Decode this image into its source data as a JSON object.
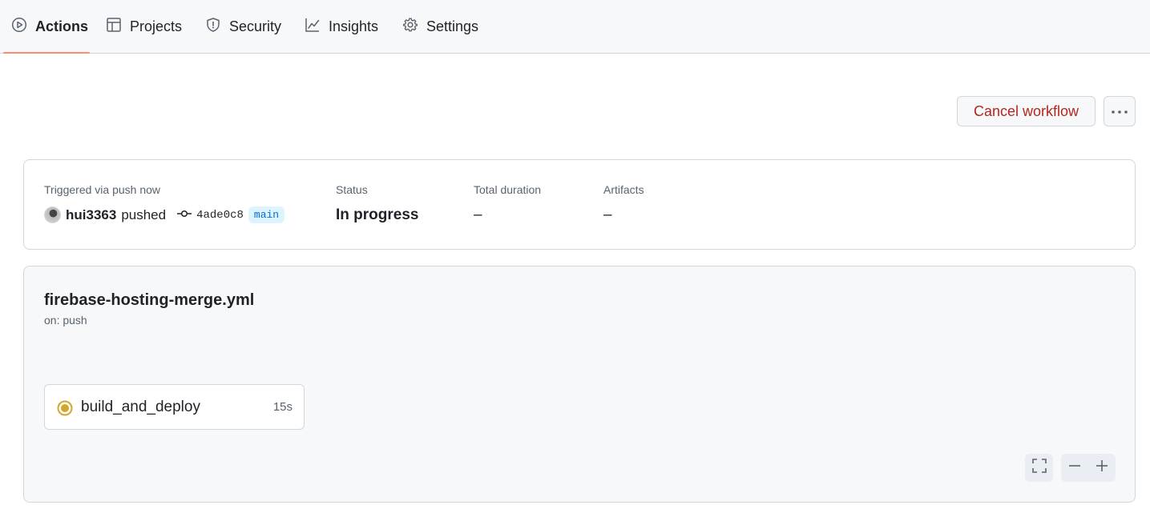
{
  "nav": {
    "tabs": [
      {
        "label": "Actions",
        "icon": "play-circle-icon",
        "active": true
      },
      {
        "label": "Projects",
        "icon": "table-icon",
        "active": false
      },
      {
        "label": "Security",
        "icon": "shield-icon",
        "active": false
      },
      {
        "label": "Insights",
        "icon": "graph-icon",
        "active": false
      },
      {
        "label": "Settings",
        "icon": "gear-icon",
        "active": false
      }
    ],
    "active_underline_color": "#fd8c73"
  },
  "header": {
    "cancel_label": "Cancel workflow",
    "more_icon": "kebab-horizontal-icon"
  },
  "summary": {
    "triggered_label": "Triggered via push now",
    "user": "hui3363",
    "action": "pushed",
    "commit": "4ade0c8",
    "branch": "main",
    "status_label": "Status",
    "status_value": "In progress",
    "duration_label": "Total duration",
    "duration_value": "–",
    "artifacts_label": "Artifacts",
    "artifacts_value": "–"
  },
  "graph": {
    "workflow_file": "firebase-hosting-merge.yml",
    "trigger": "on: push",
    "jobs": [
      {
        "name": "build_and_deploy",
        "duration": "15s",
        "status": "in_progress",
        "status_color": "#d4a72c"
      }
    ],
    "controls": [
      "fullscreen-icon",
      "zoom-out-icon",
      "zoom-in-icon"
    ]
  }
}
